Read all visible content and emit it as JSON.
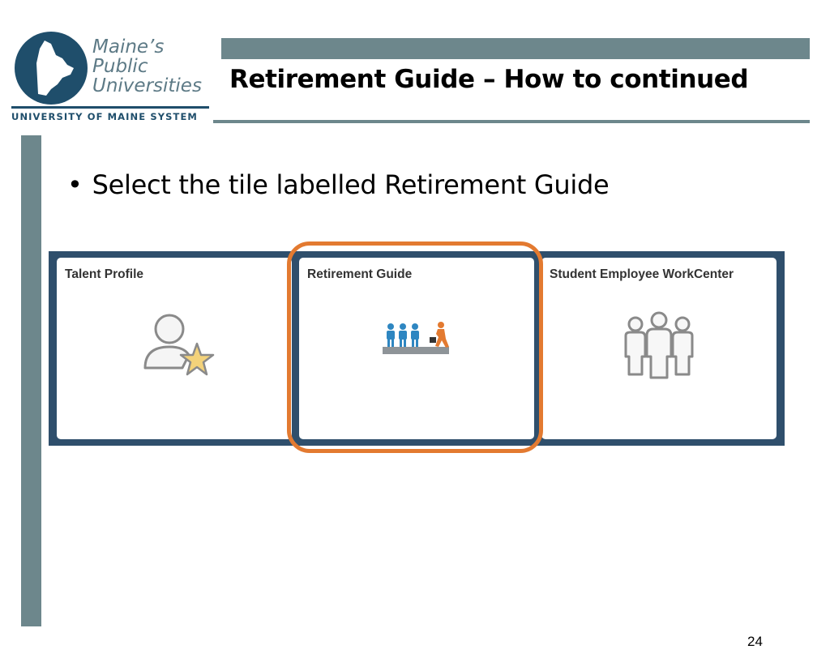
{
  "logo": {
    "line1": "Maine’s",
    "line2": "Public",
    "line3": "Universities",
    "system": "UNIVERSITY OF MAINE SYSTEM"
  },
  "slide": {
    "title": "Retirement Guide – How to continued",
    "bullet": "Select the tile labelled Retirement Guide",
    "page_number": "24"
  },
  "tiles": [
    {
      "label": "Talent Profile",
      "icon": "person-star-icon"
    },
    {
      "label": "Retirement Guide",
      "icon": "retirement-guide-icon"
    },
    {
      "label": "Student Employee WorkCenter",
      "icon": "group-icon"
    }
  ],
  "colors": {
    "bar": "#6d878c",
    "panel": "#2f4f6c",
    "highlight": "#e37a30",
    "logo_blue": "#1f4e6b"
  }
}
